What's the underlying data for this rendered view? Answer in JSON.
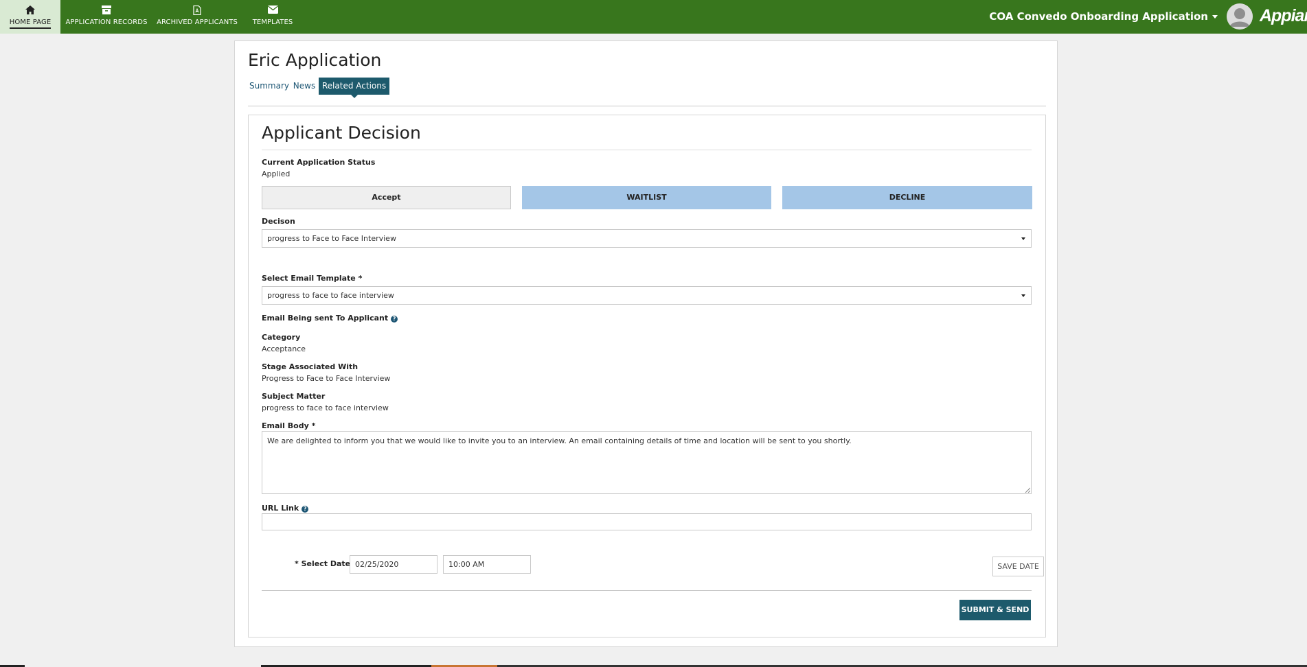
{
  "nav": {
    "home_label": "HOME PAGE",
    "records_label": "APPLICATION RECORDS",
    "archived_label": "ARCHIVED APPLICANTS",
    "templates_label": "TEMPLATES",
    "app_name": "COA Convedo Onboarding Application",
    "brand": "Appian"
  },
  "record": {
    "title": "Eric Application",
    "tabs": [
      "Summary",
      "News",
      "Related Actions"
    ]
  },
  "form": {
    "title": "Applicant Decision",
    "status_label": "Current Application Status",
    "status_value": "Applied",
    "buttons": {
      "accept": "Accept",
      "waitlist": "WAITLIST",
      "decline": "DECLINE"
    },
    "decision_label": "Decison",
    "decision_value": "progress to Face to Face Interview",
    "template_label": "Select Email Template",
    "template_value": "progress to face to face interview",
    "email_section_label": "Email Being sent To Applicant",
    "category_label": "Category",
    "category_value": "Acceptance",
    "stage_label": "Stage Associated With",
    "stage_value": "Progress to Face to Face Interview",
    "subject_label": "Subject Matter",
    "subject_value": "progress to face to face interview",
    "body_label": "Email Body",
    "body_value": "We are delighted to inform you that we would like to invite you to an interview. An email containing details of time and location will be sent to you shortly.",
    "url_label": "URL Link",
    "url_value": "",
    "date_label": "Select Date",
    "date_value": "02/25/2020",
    "time_value": "10:00 AM",
    "save_date": "SAVE DATE",
    "submit": "SUBMIT & SEND",
    "required_mark": "*",
    "help_glyph": "?"
  },
  "colors": {
    "topbar": "#38761d",
    "active_nav": "#d9ead3",
    "accent": "#1d5a6c",
    "choice_button": "#a4c6e7"
  },
  "icons": [
    "home-icon",
    "archive-box-icon",
    "document-icon",
    "envelope-icon",
    "help-icon",
    "caret-down-icon"
  ]
}
